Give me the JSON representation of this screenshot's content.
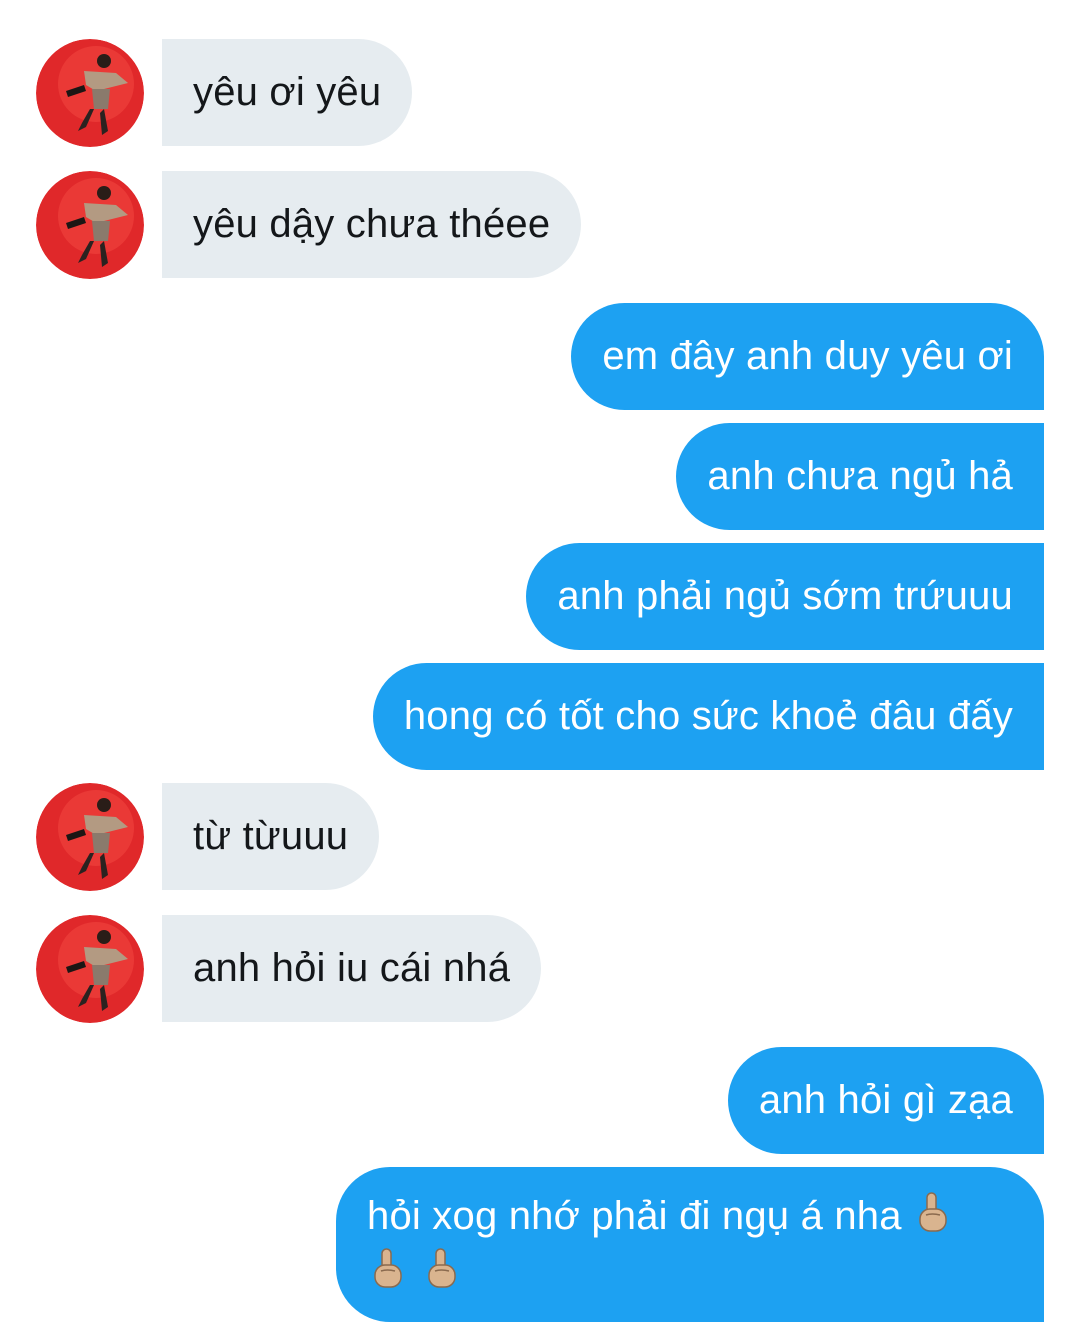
{
  "conversation": {
    "messages": [
      {
        "direction": "incoming",
        "text": "yêu ơi yêu"
      },
      {
        "direction": "incoming",
        "text": "yêu dậy chưa théee"
      },
      {
        "direction": "outgoing",
        "text": "em đây anh duy yêu ơi"
      },
      {
        "direction": "outgoing",
        "text": "anh chưa ngủ hả"
      },
      {
        "direction": "outgoing",
        "text": "anh phải ngủ sớm trứuuu"
      },
      {
        "direction": "outgoing",
        "text": "hong có tốt cho sức khoẻ đâu đấy"
      },
      {
        "direction": "incoming",
        "text": "từ từuuu"
      },
      {
        "direction": "incoming",
        "text": "anh hỏi iu cái nhá"
      },
      {
        "direction": "outgoing",
        "text": "anh hỏi gì zạa"
      },
      {
        "direction": "outgoing",
        "text": "hỏi xog nhớ phải đi ngụ á nha",
        "emoji": "point-up-medium-light-skin-tone x3"
      }
    ]
  },
  "colors": {
    "incoming_bubble": "#e6ecf0",
    "incoming_text": "#14171a",
    "outgoing_bubble": "#1da1f2",
    "outgoing_text": "#ffffff",
    "avatar_background": "#e0282a"
  },
  "icons": {
    "avatar": "contact-avatar",
    "emoji": "index-pointing-up-emoji"
  }
}
